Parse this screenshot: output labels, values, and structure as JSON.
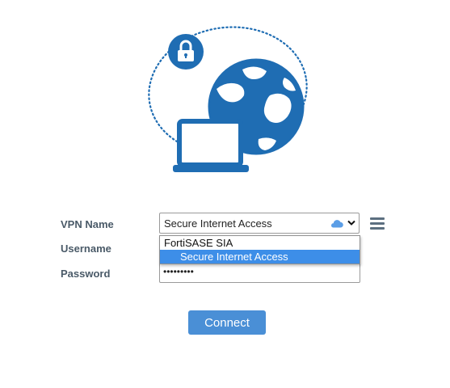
{
  "form": {
    "vpn_name_label": "VPN Name",
    "username_label": "Username",
    "password_label": "Password",
    "vpn_selected": "Secure Internet Access",
    "password_masked": "•••••••••"
  },
  "dropdown": {
    "group_label": "FortiSASE SIA",
    "options": [
      {
        "label": "Secure Internet Access",
        "highlighted": true
      }
    ]
  },
  "icons": {
    "hero": "lock-globe-laptop-illustration",
    "vpn_type": "cloud-icon",
    "select_arrow": "chevron-down-icon",
    "settings": "hamburger-menu-icon"
  },
  "colors": {
    "brand_blue": "#1f6db3",
    "highlight": "#3d8ee8",
    "button": "#4a8fd6",
    "cloud": "#5b9ee6",
    "menu_icon": "#5c6f80",
    "label_text": "#4a5a68"
  },
  "connect_button": {
    "label": "Connect"
  }
}
